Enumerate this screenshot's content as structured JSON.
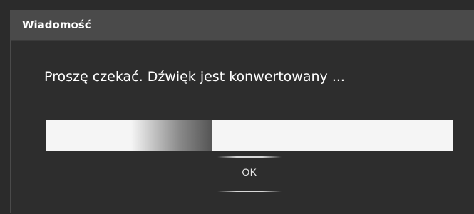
{
  "dialog": {
    "title": "Wiadomość",
    "message": "Proszę czekać. Dźwięk jest konwertowany ...",
    "progress": {
      "chunk_start_fraction": 0.21,
      "chunk_end_fraction": 0.408
    },
    "ok_label": "OK"
  },
  "colors": {
    "titlebar": "#4a4a4a",
    "background": "#2d2d2d",
    "progress_track": "#f5f5f5",
    "progress_chunk_dark": "#555555",
    "text": "#ffffff"
  }
}
